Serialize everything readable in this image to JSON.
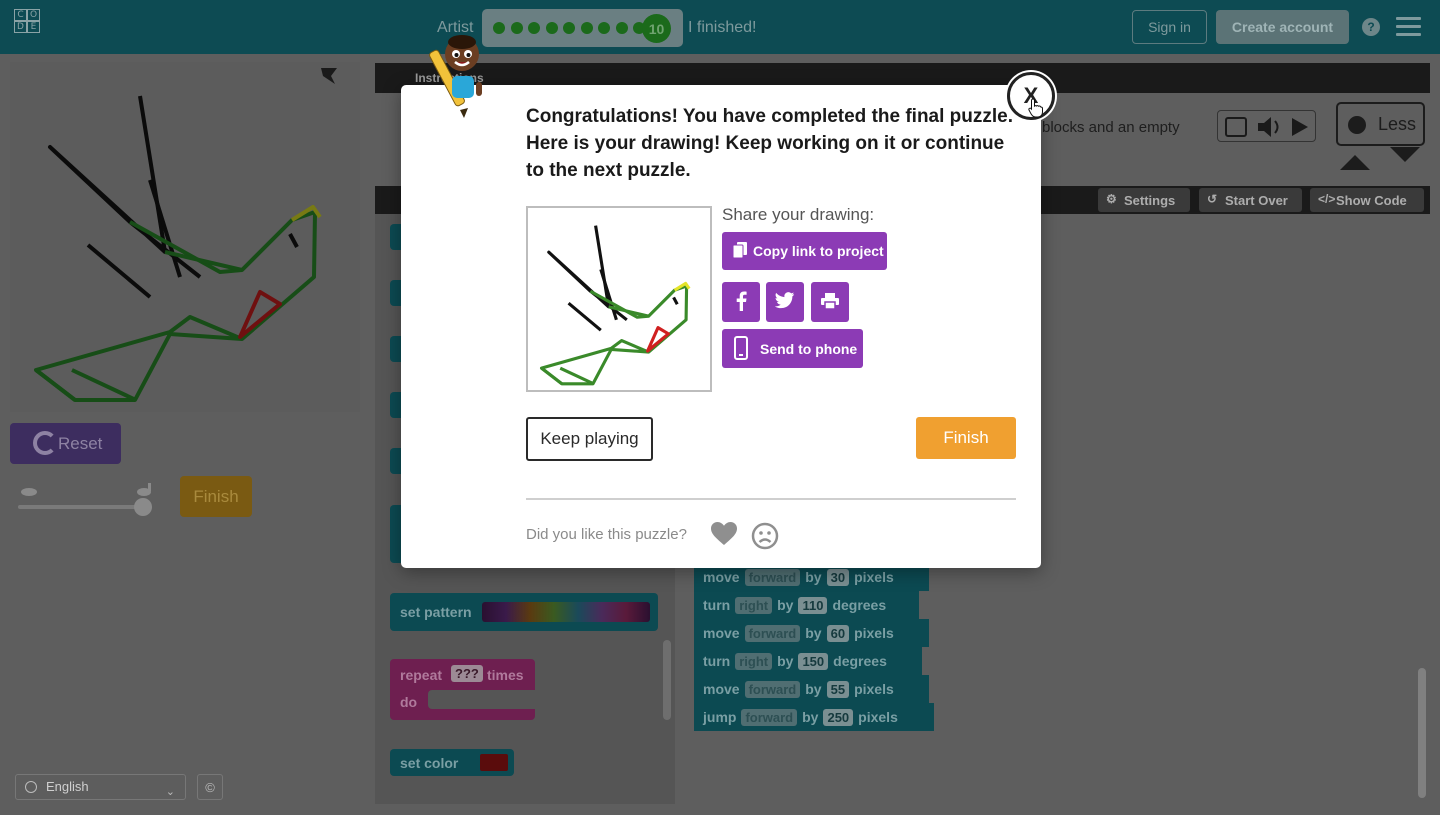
{
  "header": {
    "logo_letters": [
      "C",
      "O",
      "D",
      "E"
    ],
    "title": "Artist",
    "progress_dots": 9,
    "current_level": "10",
    "finished_text": "I finished!",
    "signin_label": "Sign in",
    "create_account_label": "Create account",
    "help_label": "?"
  },
  "left": {
    "reset_label": "Reset",
    "finish_label": "Finish",
    "language": "English"
  },
  "instructions": {
    "header_label": "Instructions",
    "text": "blocks and an empty",
    "less_label": "Less"
  },
  "workspace": {
    "settings_label": "Settings",
    "start_over_label": "Start Over",
    "show_code_label": "Show Code"
  },
  "toolbox": {
    "set_pattern_label": "set pattern",
    "repeat_label": "repeat",
    "repeat_value": "???",
    "times_label": "times",
    "do_label": "do",
    "set_color_label": "set color"
  },
  "code": [
    {
      "verb": "move",
      "dir": "forward",
      "by": "by",
      "value": "30",
      "unit": "pixels"
    },
    {
      "verb": "turn",
      "dir": "right",
      "by": "by",
      "value": "110",
      "unit": "degrees"
    },
    {
      "verb": "move",
      "dir": "forward",
      "by": "by",
      "value": "60",
      "unit": "pixels"
    },
    {
      "verb": "turn",
      "dir": "right",
      "by": "by",
      "value": "150",
      "unit": "degrees"
    },
    {
      "verb": "move",
      "dir": "forward",
      "by": "by",
      "value": "55",
      "unit": "pixels"
    },
    {
      "verb": "jump",
      "dir": "forward",
      "by": "by",
      "value": "250",
      "unit": "pixels"
    }
  ],
  "modal": {
    "title": "Congratulations! You have completed the final puzzle. Here is your drawing! Keep working on it or continue to the next puzzle.",
    "share_label": "Share your drawing:",
    "copy_link_label": "Copy link to project",
    "send_to_phone_label": "Send to phone",
    "keep_playing_label": "Keep playing",
    "finish_label": "Finish",
    "feedback_question": "Did you like this puzzle?",
    "close_label": "X"
  },
  "colors": {
    "header_bg": "#0d4b53",
    "share_purple": "#8c3bb5",
    "finish_orange": "#f0a030",
    "drawing_green": "#3a8a2a",
    "drawing_black": "#111111",
    "drawing_red": "#d02020"
  }
}
